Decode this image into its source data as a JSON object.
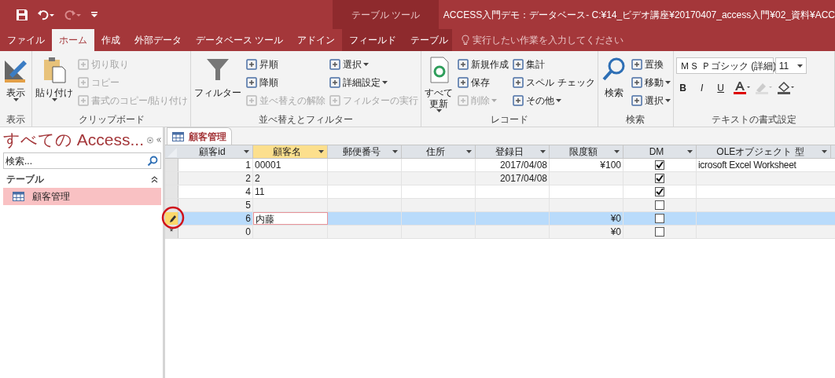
{
  "title_bar": {
    "context_label": "テーブル ツール",
    "title": "ACCESS入門デモ：データベース- C:¥14_ビデオ講座¥20170407_access入門¥02_資料¥ACC"
  },
  "ribbon_tabs": [
    {
      "label": "ファイル",
      "selected": false,
      "kind": "normal"
    },
    {
      "label": "ホーム",
      "selected": true,
      "kind": "normal"
    },
    {
      "label": "作成",
      "selected": false,
      "kind": "normal"
    },
    {
      "label": "外部データ",
      "selected": false,
      "kind": "normal"
    },
    {
      "label": "データベース ツール",
      "selected": false,
      "kind": "normal"
    },
    {
      "label": "アドイン",
      "selected": false,
      "kind": "normal"
    },
    {
      "label": "フィールド",
      "selected": false,
      "kind": "context"
    },
    {
      "label": "テーブル",
      "selected": false,
      "kind": "context"
    }
  ],
  "tell_me": {
    "placeholder": "実行したい作業を入力してください"
  },
  "ribbon_groups": [
    {
      "label": "表示",
      "kind": "commands",
      "large": {
        "label": "表示",
        "disabled": false,
        "dropdown": true
      }
    },
    {
      "label": "クリップボード",
      "kind": "commands",
      "large": {
        "label": "貼り付け",
        "disabled": false,
        "dropdown": true
      },
      "columns": [
        [
          {
            "label": "切り取り",
            "disabled": true,
            "dropdown": false
          },
          {
            "label": "コピー",
            "disabled": true,
            "dropdown": false
          },
          {
            "label": "書式のコピー/貼り付け",
            "disabled": true,
            "dropdown": false
          }
        ]
      ]
    },
    {
      "label": "並べ替えとフィルター",
      "kind": "commands",
      "large": {
        "label": "フィルター",
        "disabled": false,
        "dropdown": false
      },
      "columns": [
        [
          {
            "label": "昇順",
            "disabled": false,
            "dropdown": false
          },
          {
            "label": "降順",
            "disabled": false,
            "dropdown": false
          },
          {
            "label": "並べ替えの解除",
            "disabled": true,
            "dropdown": false
          }
        ],
        [
          {
            "label": "選択",
            "disabled": false,
            "dropdown": true
          },
          {
            "label": "詳細設定",
            "disabled": false,
            "dropdown": true
          },
          {
            "label": "フィルターの実行",
            "disabled": true,
            "dropdown": false
          }
        ]
      ]
    },
    {
      "label": "レコード",
      "kind": "commands",
      "large": {
        "lines": [
          "すべて",
          "更新"
        ],
        "disabled": false,
        "dropdown": true
      },
      "columns": [
        [
          {
            "label": "新規作成",
            "disabled": false,
            "dropdown": false
          },
          {
            "label": "保存",
            "disabled": false,
            "dropdown": false
          },
          {
            "label": "削除",
            "disabled": true,
            "dropdown": true
          }
        ],
        [
          {
            "label": "集計",
            "disabled": false,
            "dropdown": false
          },
          {
            "label": "スペル チェック",
            "disabled": false,
            "dropdown": false
          },
          {
            "label": "その他",
            "disabled": false,
            "dropdown": true
          }
        ]
      ]
    },
    {
      "label": "検索",
      "kind": "commands",
      "large": {
        "label": "検索",
        "disabled": false,
        "dropdown": false
      },
      "columns": [
        [
          {
            "label": "置換",
            "disabled": false,
            "dropdown": false
          },
          {
            "label": "移動",
            "disabled": false,
            "dropdown": true
          },
          {
            "label": "選択",
            "disabled": false,
            "dropdown": true
          }
        ]
      ]
    },
    {
      "label": "テキストの書式設定",
      "kind": "font",
      "font": "ＭＳ Ｐゴシック (詳細)",
      "size": "11",
      "format_buttons": [
        "B",
        "I",
        "U"
      ]
    }
  ],
  "nav_pane": {
    "title": "すべての Access...",
    "search_placeholder": "検索...",
    "section": "テーブル",
    "items": [
      {
        "label": "顧客管理",
        "selected": true
      }
    ]
  },
  "document_tab": "顧客管理",
  "table": {
    "columns": [
      {
        "label": "顧客id",
        "selected": false
      },
      {
        "label": "顧客名",
        "selected": true
      },
      {
        "label": "郵便番号",
        "selected": false
      },
      {
        "label": "住所",
        "selected": false
      },
      {
        "label": "登録日",
        "selected": false
      },
      {
        "label": "限度額",
        "selected": false
      },
      {
        "label": "DM",
        "selected": false
      },
      {
        "label": "OLEオブジェクト 型",
        "selected": false
      }
    ],
    "rows": [
      {
        "kind": "normal",
        "selected": false,
        "cells": [
          "1",
          "00001",
          "",
          "",
          "2017/04/08",
          "¥100"
        ],
        "dm": true,
        "ole": "icrosoft Excel Worksheet"
      },
      {
        "kind": "normal",
        "selected": false,
        "cells": [
          "2",
          "2",
          "",
          "",
          "2017/04/08",
          ""
        ],
        "dm": true
      },
      {
        "kind": "normal",
        "selected": false,
        "cells": [
          "4",
          "11",
          "",
          "",
          "",
          ""
        ],
        "dm": true
      },
      {
        "kind": "normal",
        "selected": false,
        "cells": [
          "5",
          "",
          "",
          "",
          "",
          ""
        ],
        "dm": false
      },
      {
        "kind": "editing",
        "selected": true,
        "cells": [
          "6",
          "内藤",
          "",
          "",
          "",
          "¥0"
        ],
        "dm": false
      },
      {
        "kind": "new",
        "selected": false,
        "symbol": "*",
        "cells": [
          "0",
          "",
          "",
          "",
          "",
          "¥0"
        ],
        "dm": false
      }
    ]
  }
}
